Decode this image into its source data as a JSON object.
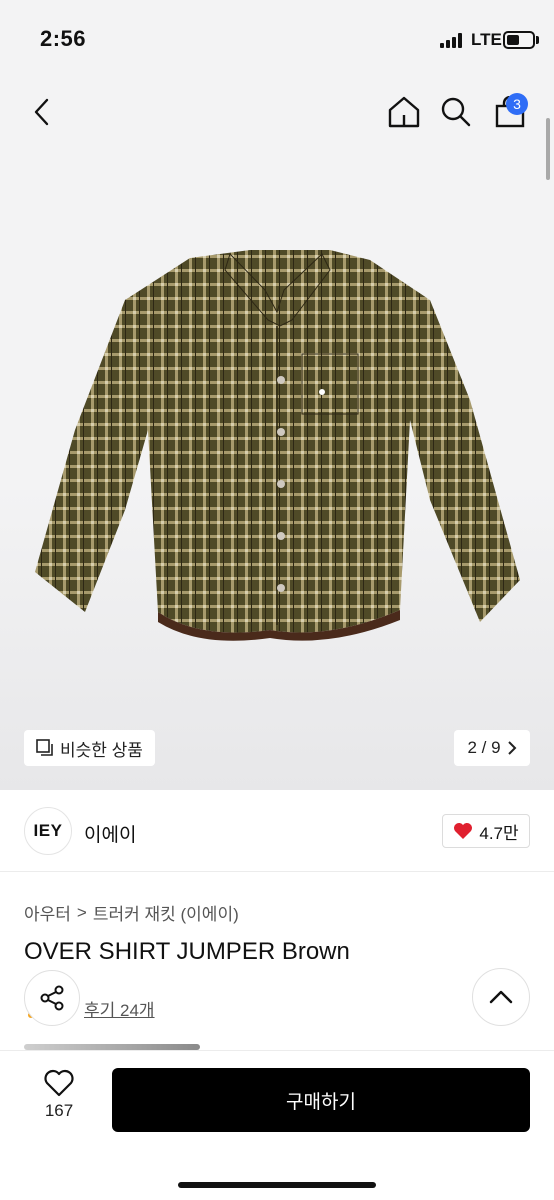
{
  "status_bar": {
    "time": "2:56",
    "network": "LTE",
    "battery_level": 0.5
  },
  "nav": {
    "back_icon": "chevron-left-icon",
    "home_icon": "home-icon",
    "search_icon": "search-icon",
    "cart_icon": "shopping-bag-icon",
    "cart_count": "3",
    "badge_color": "#2f6df6"
  },
  "gallery": {
    "similar_label": "비슷한 상품",
    "counter": "2 / 9",
    "current_index": 2,
    "total": 9
  },
  "brand": {
    "logo_text": "IEY",
    "name": "이에이",
    "likes": "4.7만",
    "heart_color": "#e0202f"
  },
  "breadcrumb": {
    "category": "아우터",
    "separator": ">",
    "subcategory": "트러커 재킷 (이에이)"
  },
  "product": {
    "title": "OVER SHIRT JUMPER Brown",
    "reviews": "후기 24개"
  },
  "bottom_bar": {
    "wish_count": "167",
    "buy_label": "구매하기"
  }
}
